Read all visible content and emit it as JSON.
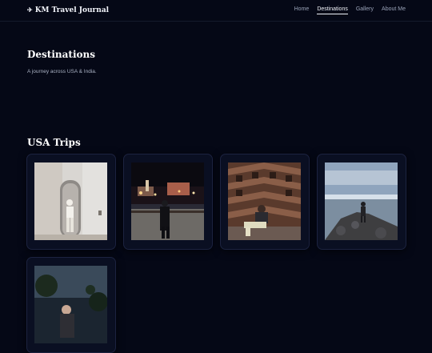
{
  "nav": {
    "brand_icon": "airplane-icon",
    "brand": "KM Travel Journal",
    "links": [
      "Home",
      "Destinations",
      "Gallery",
      "About Me"
    ],
    "active_index": 1
  },
  "hero": {
    "title": "Destinations",
    "subtitle": "A journey across USA & India."
  },
  "section": {
    "title": "USA Trips"
  }
}
